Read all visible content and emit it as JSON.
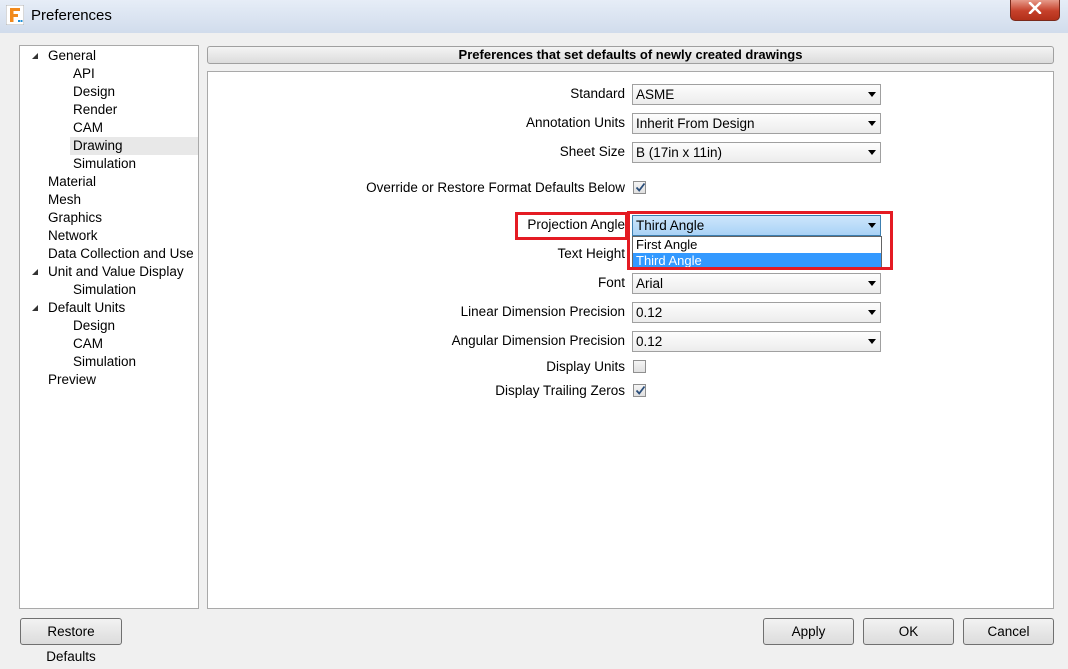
{
  "window": {
    "title": "Preferences",
    "app_icon": "fusion-app-icon"
  },
  "tree": {
    "items": [
      {
        "label": "General",
        "expandable": true,
        "expanded": true
      },
      {
        "label": "API"
      },
      {
        "label": "Design"
      },
      {
        "label": "Render"
      },
      {
        "label": "CAM"
      },
      {
        "label": "Drawing",
        "selected": true
      },
      {
        "label": "Simulation"
      },
      {
        "label": "Material"
      },
      {
        "label": "Mesh"
      },
      {
        "label": "Graphics"
      },
      {
        "label": "Network"
      },
      {
        "label": "Data Collection and Use"
      },
      {
        "label": "Unit and Value Display",
        "expandable": true,
        "expanded": true
      },
      {
        "label": "Simulation"
      },
      {
        "label": "Default Units",
        "expandable": true,
        "expanded": true
      },
      {
        "label": "Design"
      },
      {
        "label": "CAM"
      },
      {
        "label": "Simulation"
      },
      {
        "label": "Preview"
      }
    ]
  },
  "panel": {
    "header": "Preferences that set defaults of newly created drawings",
    "fields": {
      "standard": {
        "label": "Standard",
        "value": "ASME"
      },
      "annotation_units": {
        "label": "Annotation Units",
        "value": "Inherit From Design"
      },
      "sheet_size": {
        "label": "Sheet Size",
        "value": "B (17in x 11in)"
      },
      "override": {
        "label": "Override or Restore Format Defaults Below",
        "checked": true
      },
      "projection_angle": {
        "label": "Projection Angle",
        "value": "Third Angle",
        "options": [
          "First Angle",
          "Third Angle"
        ],
        "highlighted": "Third Angle"
      },
      "text_height": {
        "label": "Text Height"
      },
      "font": {
        "label": "Font",
        "value": "Arial"
      },
      "linear_precision": {
        "label": "Linear Dimension Precision",
        "value": "0.12"
      },
      "angular_precision": {
        "label": "Angular Dimension Precision",
        "value": "0.12"
      },
      "display_units": {
        "label": "Display Units",
        "checked": false
      },
      "trailing_zeros": {
        "label": "Display Trailing Zeros",
        "checked": true
      }
    }
  },
  "buttons": {
    "restore_defaults": "Restore Defaults",
    "apply": "Apply",
    "ok": "OK",
    "cancel": "Cancel"
  },
  "colors": {
    "highlight_box": "#e41b23",
    "selection": "#3399ff"
  }
}
